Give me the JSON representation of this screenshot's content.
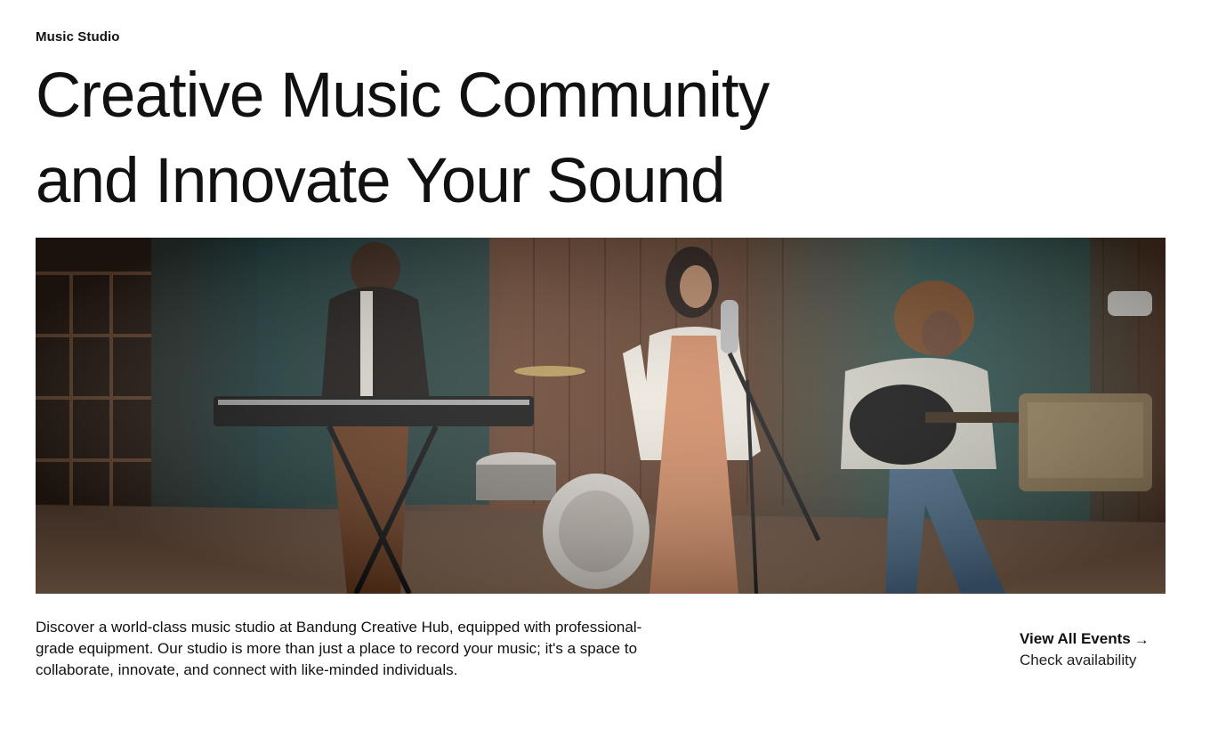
{
  "header": {
    "eyebrow": "Music Studio",
    "headline_line1": "Creative Music Community",
    "headline_line2": "and Innovate Your Sound"
  },
  "hero": {
    "icon": "studio-photo"
  },
  "body": {
    "description": "Discover a world-class music studio at Bandung Creative Hub, equipped with professional-grade equipment. Our studio is more than just a place to record your music; it's a space to collaborate, innovate, and connect with like-minded individuals."
  },
  "cta": {
    "label": "View All Events",
    "arrow": "→",
    "sub_label": "Check availability"
  },
  "colors": {
    "text": "#111111",
    "background": "#ffffff",
    "photo_wood": "#6b4530",
    "photo_teal": "#2f5c5a",
    "photo_dress": "#d08a63"
  }
}
